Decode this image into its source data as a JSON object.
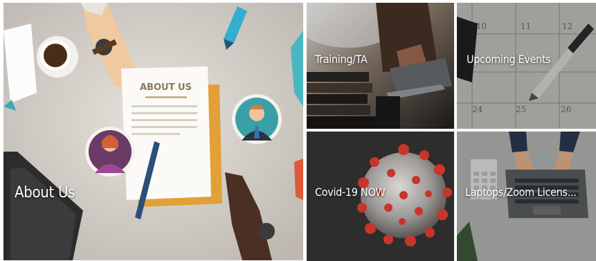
{
  "tiles": {
    "about_us": {
      "label": "About Us",
      "doc_heading": "ABOUT US"
    },
    "training": {
      "label": "Training/TA"
    },
    "events": {
      "label": "Upcoming Events",
      "calendar_numbers": [
        "10",
        "11",
        "12",
        "24",
        "25",
        "26"
      ]
    },
    "covid": {
      "label": "Covid-19 NOW"
    },
    "laptops": {
      "label": "Laptops/Zoom Licens..."
    }
  }
}
